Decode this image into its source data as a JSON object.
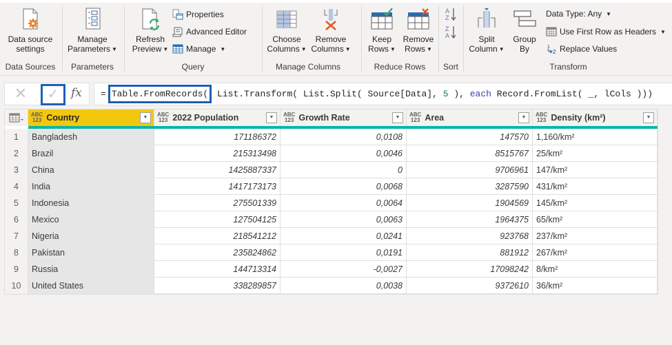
{
  "ribbon": {
    "groups": {
      "data_sources": "Data Sources",
      "parameters": "Parameters",
      "query": "Query",
      "manage_columns": "Manage Columns",
      "reduce_rows": "Reduce Rows",
      "sort": "Sort",
      "transform": "Transform"
    },
    "buttons": {
      "data_source_settings": [
        "Data source",
        "settings"
      ],
      "manage_parameters": [
        "Manage",
        "Parameters"
      ],
      "refresh_preview": [
        "Refresh",
        "Preview"
      ],
      "properties": "Properties",
      "advanced_editor": "Advanced Editor",
      "manage": "Manage",
      "choose_columns": [
        "Choose",
        "Columns"
      ],
      "remove_columns": [
        "Remove",
        "Columns"
      ],
      "keep_rows": [
        "Keep",
        "Rows"
      ],
      "remove_rows": [
        "Remove",
        "Rows"
      ],
      "split_column": [
        "Split",
        "Column"
      ],
      "group_by": [
        "Group",
        "By"
      ],
      "data_type": "Data Type: Any",
      "use_first_row": "Use First Row as Headers",
      "replace_values": "Replace Values"
    }
  },
  "formula_bar": {
    "prefix": "=",
    "highlight": "Table.FromRecords(",
    "part1": " List.Transform( List.Split( Source[Data], ",
    "num": "5",
    "part2": " ), ",
    "each": "each",
    "part3": " Record.FromList( _, lCols )))",
    "fx_label": "fx"
  },
  "colors": {
    "selected_header": "#f2c80f",
    "quality_bar": "#01b8aa",
    "highlight_box": "#1a5fb4"
  },
  "table": {
    "columns": [
      {
        "name": "Country",
        "type": "ABC/123",
        "selected": true
      },
      {
        "name": "2022 Population",
        "type": "ABC/123"
      },
      {
        "name": "Growth Rate",
        "type": "ABC/123"
      },
      {
        "name": "Area",
        "type": "ABC/123"
      },
      {
        "name": "Density (km²)",
        "type": "ABC/123"
      }
    ],
    "rows": [
      [
        "1",
        "Bangladesh",
        "171186372",
        "0,0108",
        "147570",
        "1,160/km²"
      ],
      [
        "2",
        "Brazil",
        "215313498",
        "0,0046",
        "8515767",
        "25/km²"
      ],
      [
        "3",
        "China",
        "1425887337",
        "0",
        "9706961",
        "147/km²"
      ],
      [
        "4",
        "India",
        "1417173173",
        "0,0068",
        "3287590",
        "431/km²"
      ],
      [
        "5",
        "Indonesia",
        "275501339",
        "0,0064",
        "1904569",
        "145/km²"
      ],
      [
        "6",
        "Mexico",
        "127504125",
        "0,0063",
        "1964375",
        "65/km²"
      ],
      [
        "7",
        "Nigeria",
        "218541212",
        "0,0241",
        "923768",
        "237/km²"
      ],
      [
        "8",
        "Pakistan",
        "235824862",
        "0,0191",
        "881912",
        "267/km²"
      ],
      [
        "9",
        "Russia",
        "144713314",
        "-0,0027",
        "17098242",
        "8/km²"
      ],
      [
        "10",
        "United States",
        "338289857",
        "0,0038",
        "9372610",
        "36/km²"
      ]
    ]
  }
}
